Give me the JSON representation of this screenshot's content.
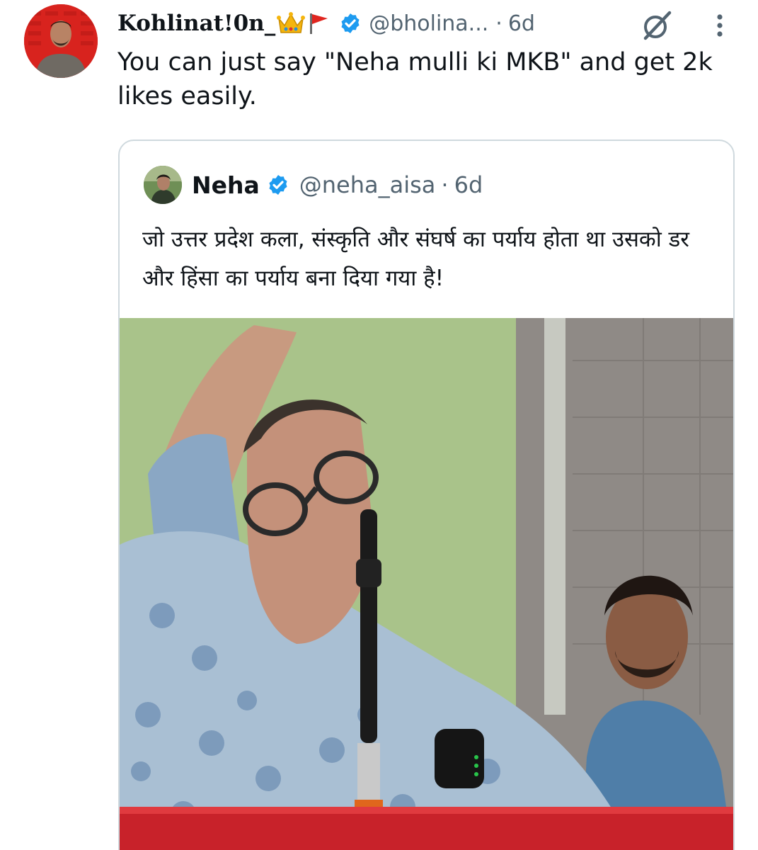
{
  "tweet": {
    "display_name": "Kohlinat!0n_",
    "name_emojis": [
      "crown-emoji",
      "red-flag-emoji"
    ],
    "verified": true,
    "handle": "@bholina...",
    "separator": "·",
    "time": "6d",
    "text": "You can just say \"Neha mulli ki MKB\" and get 2k likes easily."
  },
  "quoted_tweet": {
    "display_name": "Neha",
    "verified": true,
    "handle": "@neha_aisa",
    "separator": "·",
    "time": "6d",
    "text": "जो उत्तर प्रदेश कला, संस्कृति और संघर्ष का पर्याय होता था उसको डर और हिंसा का पर्याय बना दिया गया है!"
  },
  "icons": {
    "verified": "verified-badge-icon",
    "grok": "grok-icon",
    "more": "more-options-icon"
  },
  "colors": {
    "verified_blue": "#1d9bf0",
    "secondary_text": "#536471",
    "border": "#cfd9de",
    "avatar_red": "#d8231e"
  }
}
